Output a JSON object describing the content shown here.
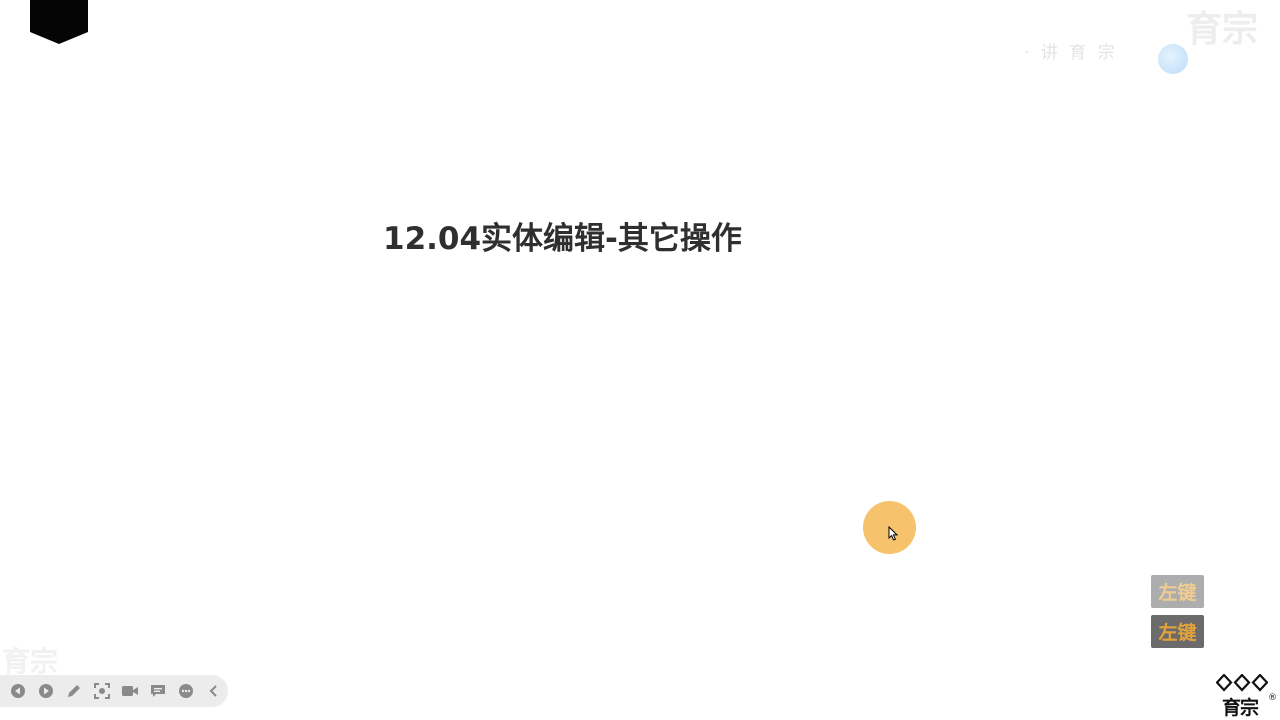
{
  "slide": {
    "title": "12.04实体编辑-其它操作"
  },
  "watermark": {
    "top_text": "· 讲 育 宗",
    "top_big": "育宗",
    "bottom_text": "育宗"
  },
  "key_indicator": {
    "previous": "左键",
    "current": "左键",
    "badge_bg": "#6b6b6b",
    "badge_fg": "#e2a33a"
  },
  "cursor": {
    "highlight_color": "#f6c26b"
  },
  "toolbar": {
    "buttons": [
      {
        "name": "previous-button",
        "icon": "previous-icon"
      },
      {
        "name": "next-button",
        "icon": "next-icon"
      },
      {
        "name": "pen-button",
        "icon": "pen-icon"
      },
      {
        "name": "screenshot-button",
        "icon": "screenshot-icon"
      },
      {
        "name": "camera-button",
        "icon": "camera-icon"
      },
      {
        "name": "comment-button",
        "icon": "comment-icon"
      },
      {
        "name": "more-button",
        "icon": "more-icon"
      },
      {
        "name": "collapse-button",
        "icon": "chevron-left-icon"
      }
    ]
  },
  "brand": {
    "text": "育宗",
    "mark": "®"
  }
}
